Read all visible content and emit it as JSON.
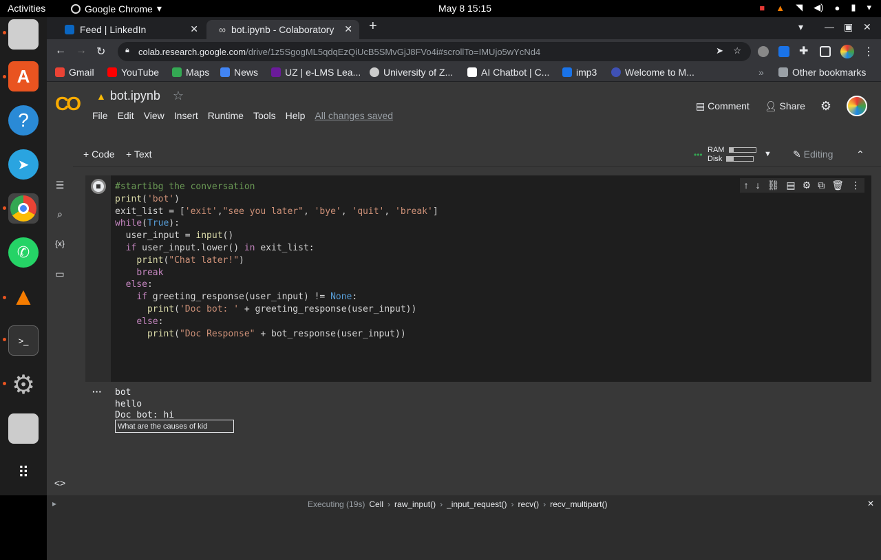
{
  "topbar": {
    "activities": "Activities",
    "app_name": "Google Chrome",
    "clock": "May 8  15:15"
  },
  "tabs": [
    {
      "label": "Feed | LinkedIn",
      "active": false
    },
    {
      "label": "bot.ipynb - Colaboratory",
      "active": true
    }
  ],
  "address": {
    "host": "colab.research.google.com",
    "path": "/drive/1z5SgogML5qdqEzQiUcB5SMvGjJ8FVo4i#scrollTo=IMUjo5wYcNd4"
  },
  "bookmarks": [
    {
      "label": "Gmail",
      "color": "#ea4335"
    },
    {
      "label": "YouTube",
      "color": "#ff0000"
    },
    {
      "label": "Maps",
      "color": "#34a853"
    },
    {
      "label": "News",
      "color": "#4285f4"
    },
    {
      "label": "UZ | e-LMS Lea...",
      "color": "#6a1b9a"
    },
    {
      "label": "University of Z...",
      "color": "#cccccc"
    },
    {
      "label": "AI Chatbot | C...",
      "color": "#ffffff"
    },
    {
      "label": "imp3",
      "color": "#1a73e8"
    },
    {
      "label": "Welcome to M...",
      "color": "#3f51b5"
    }
  ],
  "other_bookmarks": "Other bookmarks",
  "colab": {
    "logo": "CO",
    "notebook_title": "bot.ipynb",
    "menu": [
      "File",
      "Edit",
      "View",
      "Insert",
      "Runtime",
      "Tools",
      "Help"
    ],
    "saved_status": "All changes saved",
    "comment": "Comment",
    "share": "Share",
    "add_code": "+ Code",
    "add_text": "+ Text",
    "ram_label": "RAM",
    "disk_label": "Disk",
    "ram_fraction": 0.15,
    "disk_fraction": 0.25,
    "editing": "Editing"
  },
  "code_lines": [
    "#startibg the conversation",
    "print('bot')",
    "exit_list = ['exit',\"see you later\", 'bye', 'quit', 'break']",
    "while(True):",
    "  user_input = input()",
    "  if user_input.lower() in exit_list:",
    "    print(\"Chat later!\")",
    "    break",
    "  else:",
    "    if greeting_response(user_input) != None:",
    "      print('Doc bot: ' + greeting_response(user_input))",
    "    else:",
    "      print(\"Doc Response\" + bot_response(user_input))"
  ],
  "output": {
    "lines": "bot\nhello\nDoc bot: hi",
    "input_value": "What are the causes of kid"
  },
  "status": {
    "executing": "Executing (19s)",
    "trace": [
      "Cell",
      "raw_input()",
      "_input_request()",
      "recv()",
      "recv_multipart()"
    ]
  }
}
